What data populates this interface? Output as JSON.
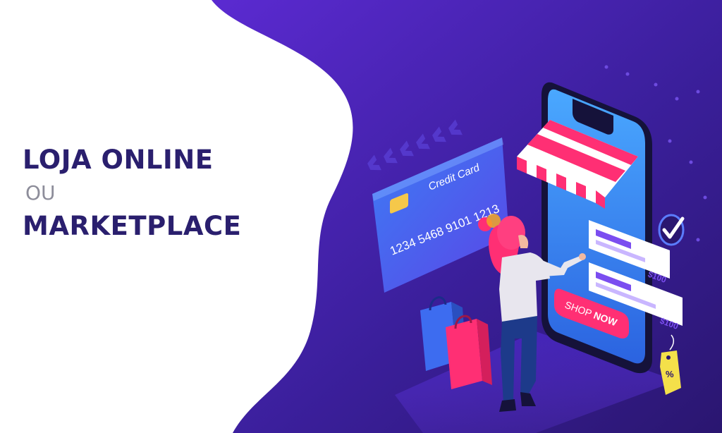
{
  "headline": {
    "line1": "LOJA ONLINE",
    "line2": "OU",
    "line3": "MARKETPLACE"
  },
  "card": {
    "label": "Credit Card",
    "number": "1234 5468 9101 1213"
  },
  "phone": {
    "button_label_1": "SHOP",
    "button_label_2": "NOW",
    "price_1": "$100",
    "price_2": "$100"
  },
  "tag": {
    "label": "%"
  },
  "colors": {
    "headline": "#2a1f6e",
    "background_purple": "#3a1fa8",
    "accent_pink": "#ff2f74"
  }
}
